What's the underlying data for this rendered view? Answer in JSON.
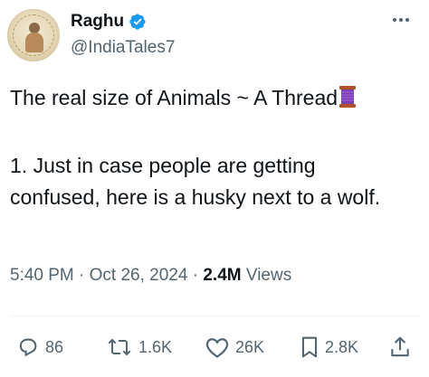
{
  "author": {
    "display_name": "Raghu",
    "handle": "@IndiaTales7",
    "verified": true,
    "avatar_icon": "avatar-photo-icon"
  },
  "tweet": {
    "line1": "The real size of Animals ~ A Thread",
    "line1_emoji": "spool-of-thread-icon",
    "paragraph2": "1. Just in case people are getting confused, here is a husky next to a wolf."
  },
  "meta": {
    "time": "5:40 PM",
    "separator": " · ",
    "date": "Oct 26, 2024",
    "views_count": "2.4M",
    "views_label": " Views"
  },
  "actions": {
    "replies": "86",
    "reposts": "1.6K",
    "likes": "26K",
    "bookmarks": "2.8K"
  },
  "colors": {
    "text_primary": "#0f1419",
    "text_secondary": "#536471",
    "verified_blue": "#1d9bf0",
    "divider": "#eff3f4"
  }
}
